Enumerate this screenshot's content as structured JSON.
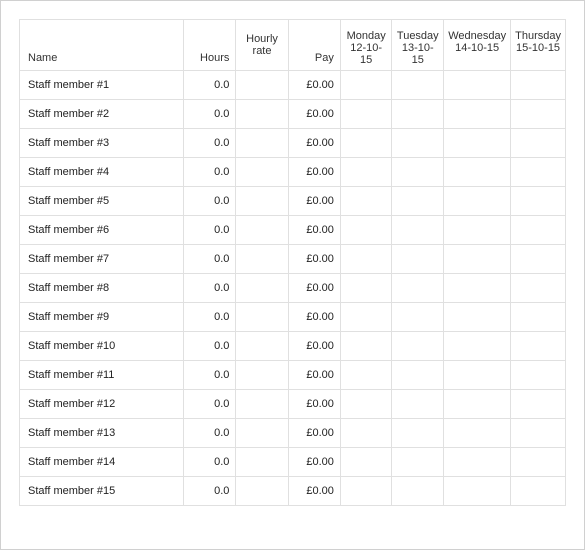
{
  "headers": {
    "name": "Name",
    "hours": "Hours",
    "rate_line1": "Hourly",
    "rate_line2": "rate",
    "pay": "Pay",
    "days": [
      {
        "weekday": "Monday",
        "date": "12-10-15"
      },
      {
        "weekday": "Tuesday",
        "date": "13-10-15"
      },
      {
        "weekday": "Wednesday",
        "date": "14-10-15"
      },
      {
        "weekday": "Thursday",
        "date": "15-10-15"
      }
    ]
  },
  "rows": [
    {
      "name": "Staff member #1",
      "hours": "0.0",
      "rate": "",
      "pay": "£0.00",
      "d0": "",
      "d1": "",
      "d2": "",
      "d3": ""
    },
    {
      "name": "Staff member #2",
      "hours": "0.0",
      "rate": "",
      "pay": "£0.00",
      "d0": "",
      "d1": "",
      "d2": "",
      "d3": ""
    },
    {
      "name": "Staff member #3",
      "hours": "0.0",
      "rate": "",
      "pay": "£0.00",
      "d0": "",
      "d1": "",
      "d2": "",
      "d3": ""
    },
    {
      "name": "Staff member #4",
      "hours": "0.0",
      "rate": "",
      "pay": "£0.00",
      "d0": "",
      "d1": "",
      "d2": "",
      "d3": ""
    },
    {
      "name": "Staff member #5",
      "hours": "0.0",
      "rate": "",
      "pay": "£0.00",
      "d0": "",
      "d1": "",
      "d2": "",
      "d3": ""
    },
    {
      "name": "Staff member #6",
      "hours": "0.0",
      "rate": "",
      "pay": "£0.00",
      "d0": "",
      "d1": "",
      "d2": "",
      "d3": ""
    },
    {
      "name": "Staff member #7",
      "hours": "0.0",
      "rate": "",
      "pay": "£0.00",
      "d0": "",
      "d1": "",
      "d2": "",
      "d3": ""
    },
    {
      "name": "Staff member #8",
      "hours": "0.0",
      "rate": "",
      "pay": "£0.00",
      "d0": "",
      "d1": "",
      "d2": "",
      "d3": ""
    },
    {
      "name": "Staff member #9",
      "hours": "0.0",
      "rate": "",
      "pay": "£0.00",
      "d0": "",
      "d1": "",
      "d2": "",
      "d3": ""
    },
    {
      "name": "Staff member #10",
      "hours": "0.0",
      "rate": "",
      "pay": "£0.00",
      "d0": "",
      "d1": "",
      "d2": "",
      "d3": ""
    },
    {
      "name": "Staff member #11",
      "hours": "0.0",
      "rate": "",
      "pay": "£0.00",
      "d0": "",
      "d1": "",
      "d2": "",
      "d3": ""
    },
    {
      "name": "Staff member #12",
      "hours": "0.0",
      "rate": "",
      "pay": "£0.00",
      "d0": "",
      "d1": "",
      "d2": "",
      "d3": ""
    },
    {
      "name": "Staff member #13",
      "hours": "0.0",
      "rate": "",
      "pay": "£0.00",
      "d0": "",
      "d1": "",
      "d2": "",
      "d3": ""
    },
    {
      "name": "Staff member #14",
      "hours": "0.0",
      "rate": "",
      "pay": "£0.00",
      "d0": "",
      "d1": "",
      "d2": "",
      "d3": ""
    },
    {
      "name": "Staff member #15",
      "hours": "0.0",
      "rate": "",
      "pay": "£0.00",
      "d0": "",
      "d1": "",
      "d2": "",
      "d3": ""
    }
  ]
}
